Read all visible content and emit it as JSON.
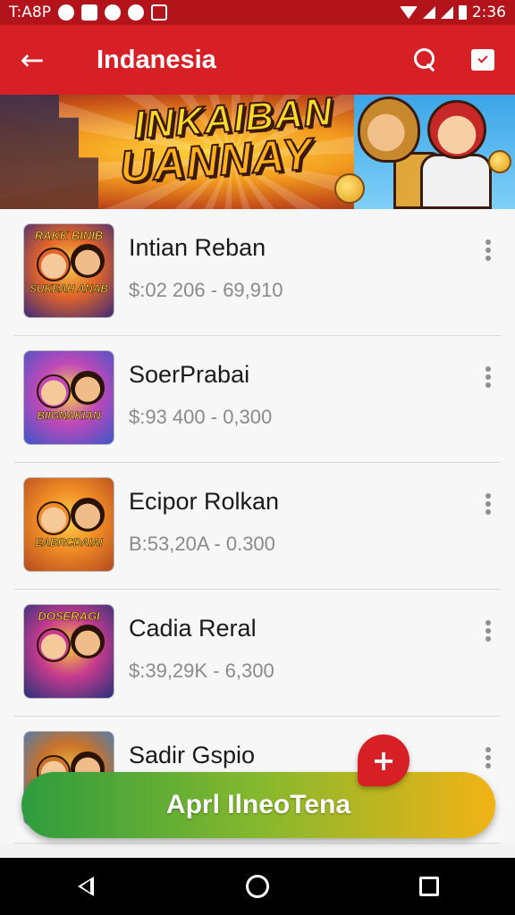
{
  "status_bar": {
    "left_text": "T:A8P",
    "icons": [
      "notification-icon",
      "message-icon",
      "play-icon",
      "gear-icon",
      "image-icon"
    ],
    "time": "2:36"
  },
  "app_bar": {
    "title": "Indanesia",
    "back_icon": "arrow-left-icon",
    "search_icon": "search-icon",
    "calendar_icon": "calendar-check-icon"
  },
  "banner": {
    "line1": "INKAIBAN",
    "line2": "UANNAY"
  },
  "items": [
    {
      "title": "Intian Reban",
      "subtitle": "$:02 206 - 69,910",
      "thumb_top": "RAKK BINIB",
      "thumb_mid": "SUKEAH ANAB",
      "colors": [
        "#3d2a7a",
        "#e1642a",
        "#f7c84a"
      ]
    },
    {
      "title": "SoerPrabai",
      "subtitle": "$:93 400 - 0,300",
      "thumb_top": "",
      "thumb_mid": "BIIGNAKIAN",
      "colors": [
        "#3c57c9",
        "#c048b8",
        "#f5d04a"
      ]
    },
    {
      "title": "Ecipor Rolkan",
      "subtitle": "B:53,20A - 0.300",
      "thumb_top": "",
      "thumb_mid": "EABRCDAIAI",
      "colors": [
        "#b34a1e",
        "#f08b26",
        "#ffd24a"
      ]
    },
    {
      "title": "Cadia Reral",
      "subtitle": "$:39,29K - 6,300",
      "thumb_top": "DOSERAGI",
      "thumb_mid": "",
      "colors": [
        "#26327a",
        "#c73a8e",
        "#f7c53a"
      ]
    },
    {
      "title": "Sadir Gspio",
      "subtitle": "",
      "thumb_top": "",
      "thumb_mid": "",
      "colors": [
        "#3b7fc4",
        "#c9722a",
        "#f2c24a"
      ]
    }
  ],
  "fab": {
    "label": "+"
  },
  "cta": {
    "label": "Aprl IlneoTena"
  },
  "nav": {
    "back": "nav-back-icon",
    "home": "nav-home-icon",
    "recent": "nav-recents-icon"
  },
  "colors": {
    "primary": "#d71f26",
    "status_bar": "#b3141c",
    "cta_start": "#2e9c3e",
    "cta_end": "#f1b316"
  }
}
